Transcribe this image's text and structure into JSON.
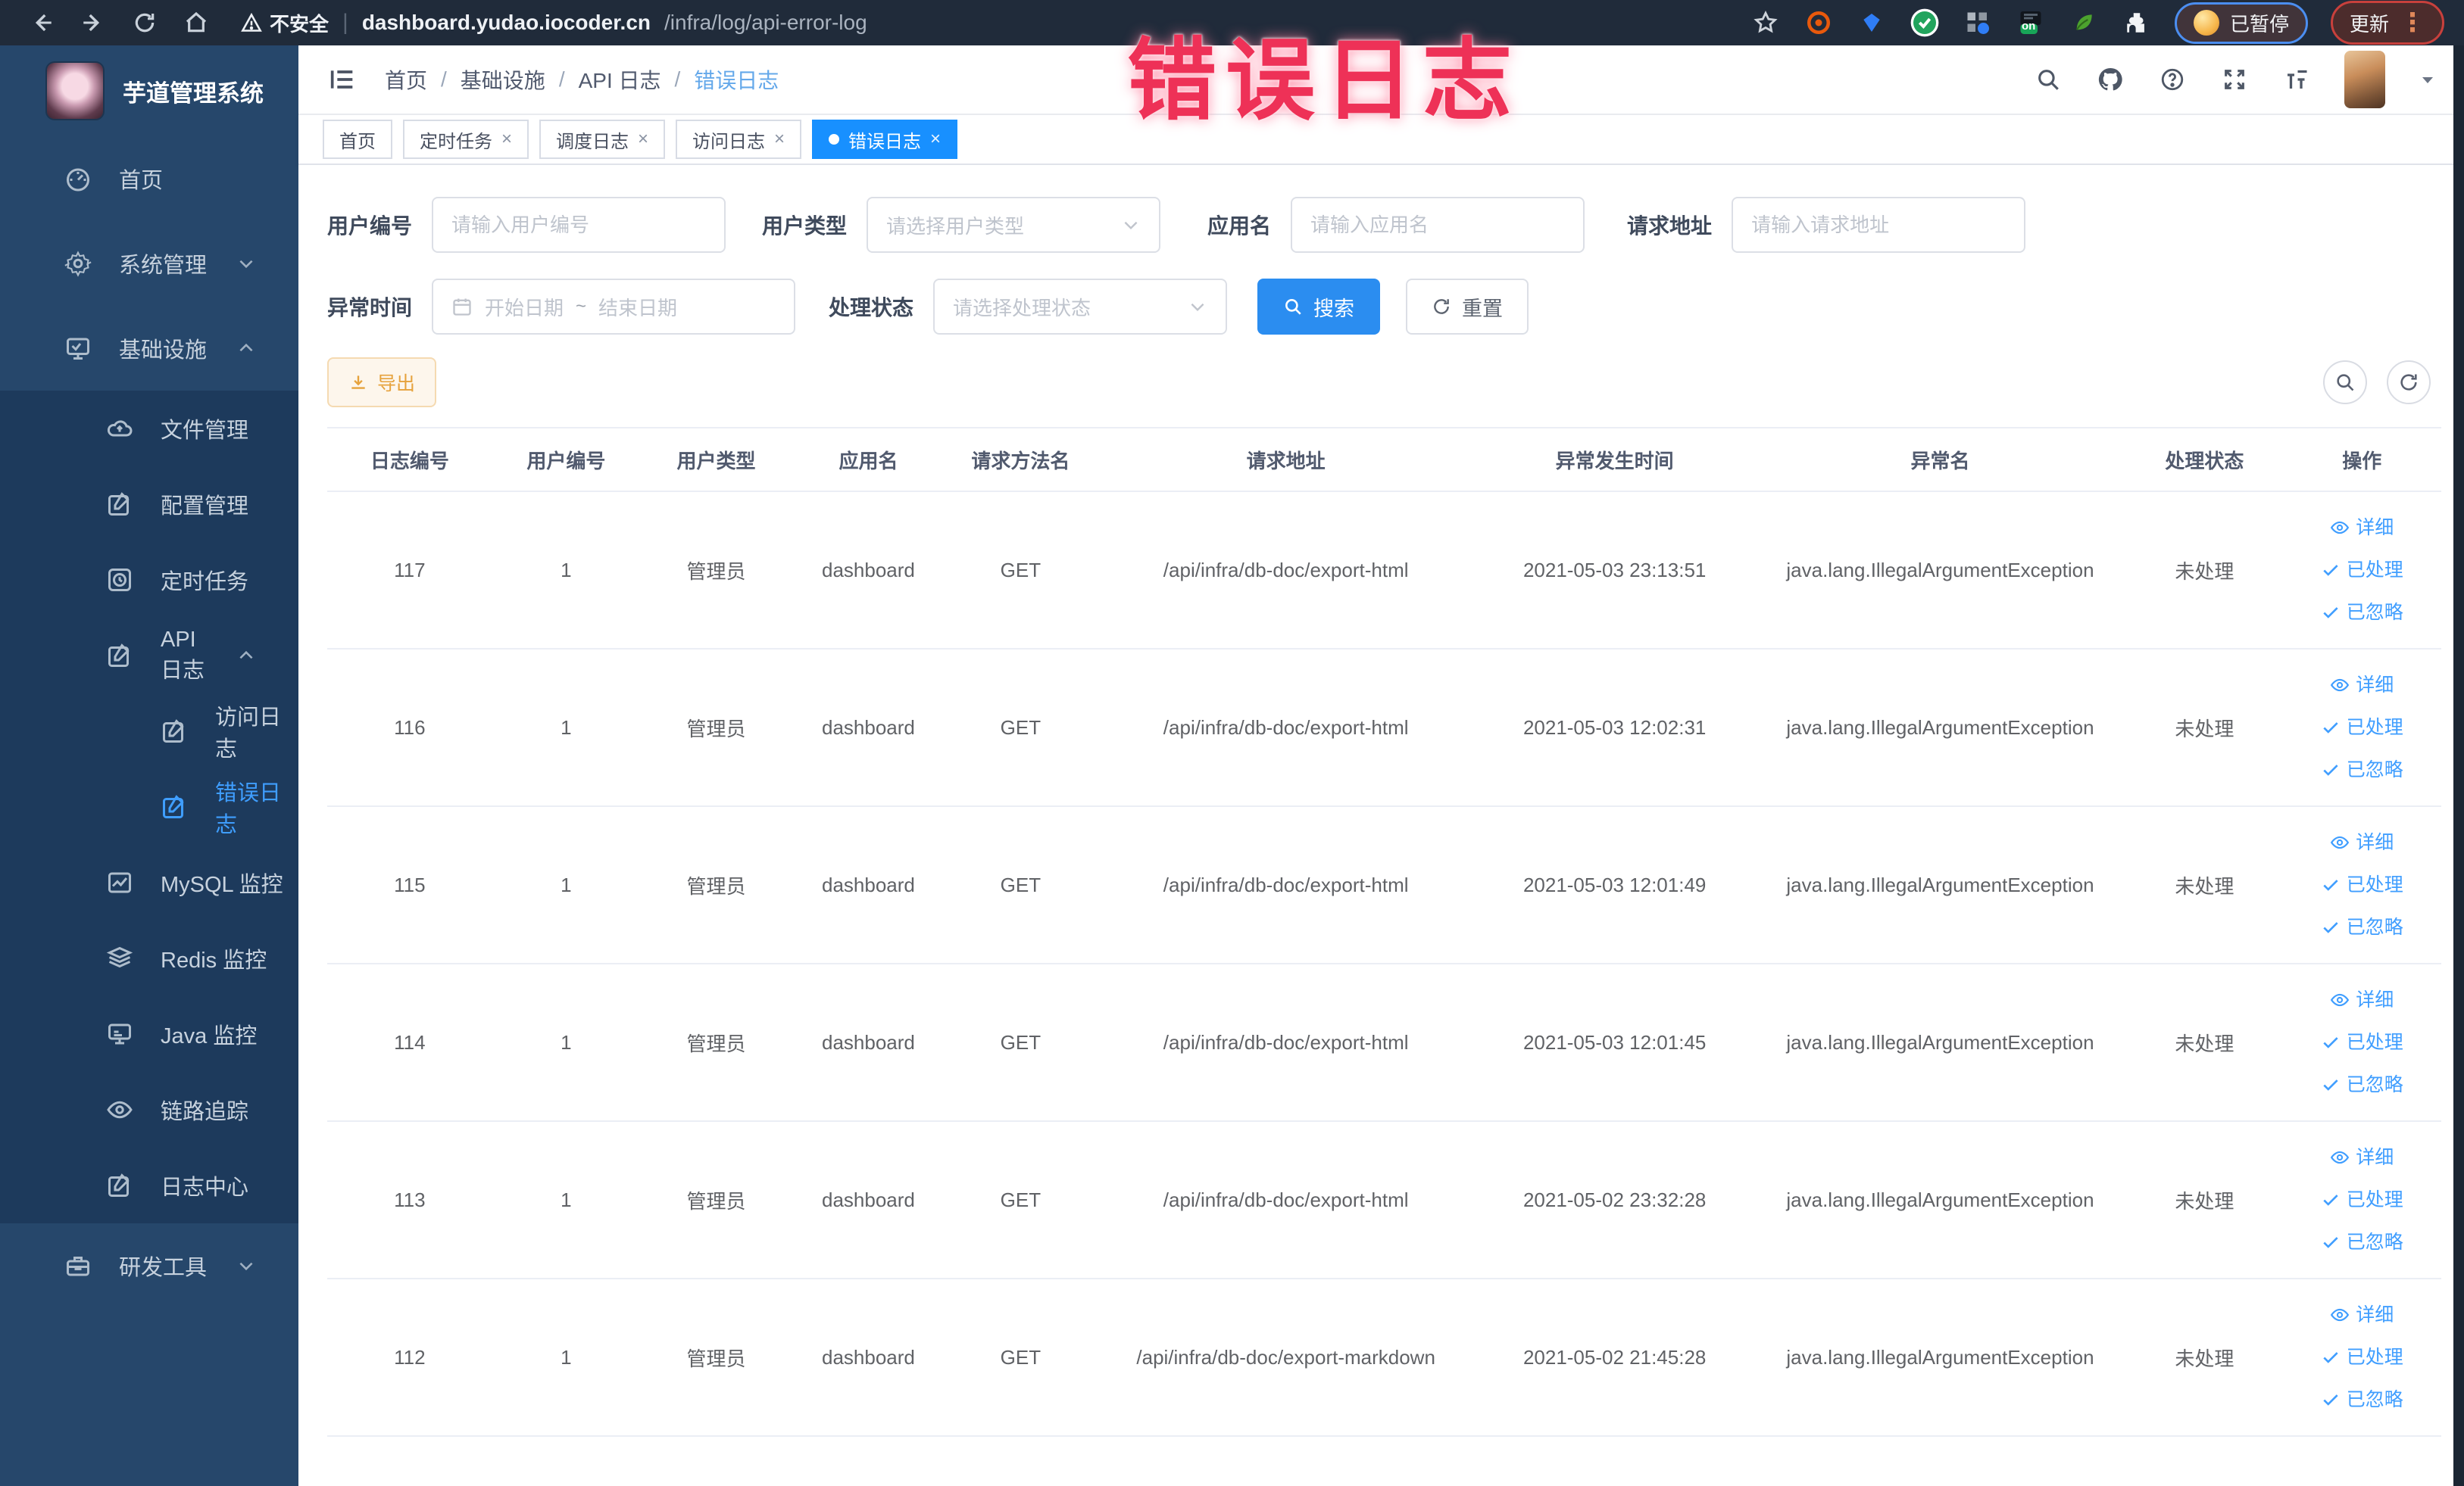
{
  "browser": {
    "security_label": "不安全",
    "url_host": "dashboard.yudao.iocoder.cn",
    "url_path": "/infra/log/api-error-log",
    "ext_on_badge": "on",
    "paused_badge": "已暂停",
    "update_badge": "更新"
  },
  "annotation": {
    "text": "错误日志",
    "color": "#ee3157"
  },
  "sidebar": {
    "title": "芋道管理系统",
    "home": "首页",
    "system": "系统管理",
    "infra": "基础设施",
    "file": "文件管理",
    "config": "配置管理",
    "job": "定时任务",
    "api_log": "API 日志",
    "access_log": "访问日志",
    "error_log": "错误日志",
    "mysql": "MySQL 监控",
    "redis": "Redis 监控",
    "java": "Java 监控",
    "trace": "链路追踪",
    "log_center": "日志中心",
    "dev_tools": "研发工具"
  },
  "header": {
    "breadcrumb": [
      "首页",
      "基础设施",
      "API 日志",
      "错误日志"
    ]
  },
  "tags": [
    {
      "label": "首页"
    },
    {
      "label": "定时任务"
    },
    {
      "label": "调度日志"
    },
    {
      "label": "访问日志"
    },
    {
      "label": "错误日志"
    }
  ],
  "filters": {
    "user_id_label": "用户编号",
    "user_id_placeholder": "请输入用户编号",
    "user_type_label": "用户类型",
    "user_type_placeholder": "请选择用户类型",
    "app_name_label": "应用名",
    "app_name_placeholder": "请输入应用名",
    "request_url_label": "请求地址",
    "request_url_placeholder": "请输入请求地址",
    "exception_time_label": "异常时间",
    "date_start_placeholder": "开始日期",
    "date_separator": "~",
    "date_end_placeholder": "结束日期",
    "process_status_label": "处理状态",
    "process_status_placeholder": "请选择处理状态",
    "search_button": "搜索",
    "reset_button": "重置"
  },
  "toolbar": {
    "export_button": "导出"
  },
  "table": {
    "columns": [
      "日志编号",
      "用户编号",
      "用户类型",
      "应用名",
      "请求方法名",
      "请求地址",
      "异常发生时间",
      "异常名",
      "处理状态",
      "操作"
    ],
    "actions": [
      "详细",
      "已处理",
      "已忽略"
    ],
    "rows": [
      {
        "id": "117",
        "user_id": "1",
        "user_type": "管理员",
        "app": "dashboard",
        "method": "GET",
        "url": "/api/infra/db-doc/export-html",
        "time": "2021-05-03 23:13:51",
        "exception": "java.lang.IllegalArgumentException",
        "status": "未处理"
      },
      {
        "id": "116",
        "user_id": "1",
        "user_type": "管理员",
        "app": "dashboard",
        "method": "GET",
        "url": "/api/infra/db-doc/export-html",
        "time": "2021-05-03 12:02:31",
        "exception": "java.lang.IllegalArgumentException",
        "status": "未处理"
      },
      {
        "id": "115",
        "user_id": "1",
        "user_type": "管理员",
        "app": "dashboard",
        "method": "GET",
        "url": "/api/infra/db-doc/export-html",
        "time": "2021-05-03 12:01:49",
        "exception": "java.lang.IllegalArgumentException",
        "status": "未处理"
      },
      {
        "id": "114",
        "user_id": "1",
        "user_type": "管理员",
        "app": "dashboard",
        "method": "GET",
        "url": "/api/infra/db-doc/export-html",
        "time": "2021-05-03 12:01:45",
        "exception": "java.lang.IllegalArgumentException",
        "status": "未处理"
      },
      {
        "id": "113",
        "user_id": "1",
        "user_type": "管理员",
        "app": "dashboard",
        "method": "GET",
        "url": "/api/infra/db-doc/export-html",
        "time": "2021-05-02 23:32:28",
        "exception": "java.lang.IllegalArgumentException",
        "status": "未处理"
      },
      {
        "id": "112",
        "user_id": "1",
        "user_type": "管理员",
        "app": "dashboard",
        "method": "GET",
        "url": "/api/infra/db-doc/export-markdown",
        "time": "2021-05-02 21:45:28",
        "exception": "java.lang.IllegalArgumentException",
        "status": "未处理"
      }
    ]
  },
  "colors": {
    "accent": "#1890ff",
    "active_tag": "#1890ff",
    "link": "#409eff",
    "warning": "#e6a23c",
    "annotation": "#ee3157"
  }
}
